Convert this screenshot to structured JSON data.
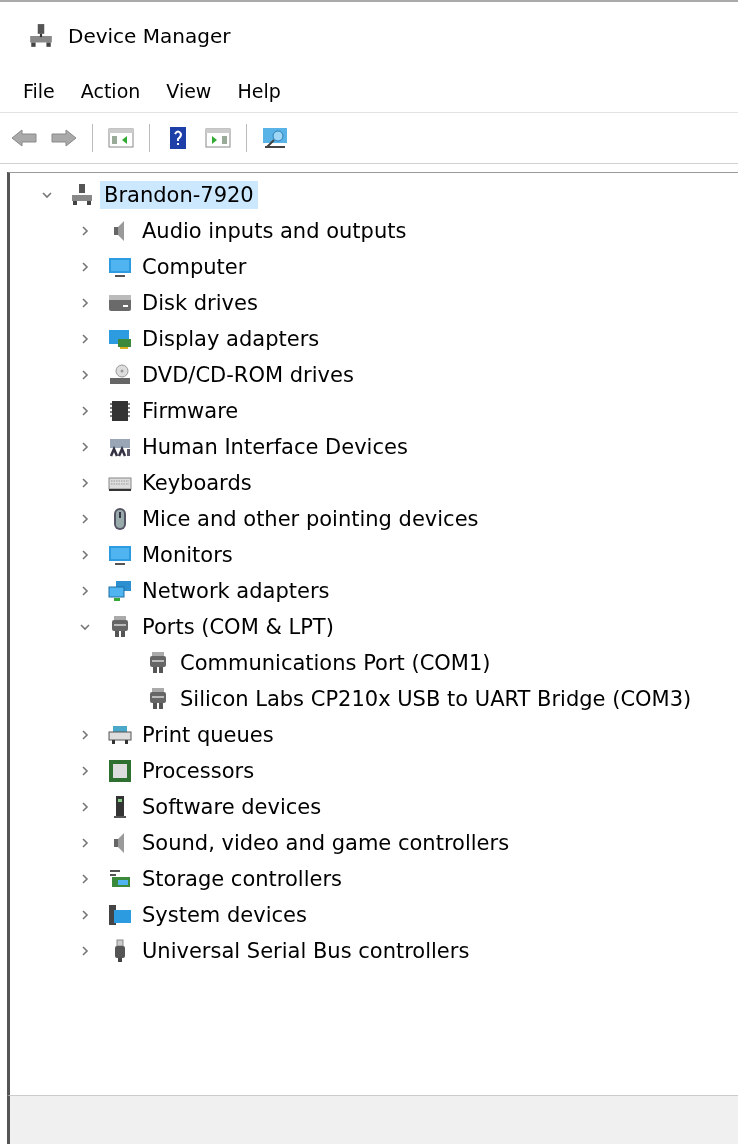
{
  "window": {
    "title": "Device Manager"
  },
  "menu": [
    "File",
    "Action",
    "View",
    "Help"
  ],
  "toolbar": [
    {
      "kind": "back"
    },
    {
      "kind": "forward"
    },
    {
      "kind": "sep"
    },
    {
      "kind": "tree"
    },
    {
      "kind": "sep"
    },
    {
      "kind": "help"
    },
    {
      "kind": "pane"
    },
    {
      "kind": "sep"
    },
    {
      "kind": "scan"
    }
  ],
  "tree": {
    "label": "Brandon-7920",
    "kind": "pc",
    "expanded": true,
    "selected": true,
    "children": [
      {
        "label": "Audio inputs and outputs",
        "kind": "speaker",
        "expanded": false,
        "selected": false
      },
      {
        "label": "Computer",
        "kind": "monitor",
        "expanded": false,
        "selected": false
      },
      {
        "label": "Disk drives",
        "kind": "disk",
        "expanded": false,
        "selected": false
      },
      {
        "label": "Display adapters",
        "kind": "display",
        "expanded": false,
        "selected": false
      },
      {
        "label": "DVD/CD-ROM drives",
        "kind": "dvd",
        "expanded": false,
        "selected": false
      },
      {
        "label": "Firmware",
        "kind": "chip",
        "expanded": false,
        "selected": false
      },
      {
        "label": "Human Interface Devices",
        "kind": "hid",
        "expanded": false,
        "selected": false
      },
      {
        "label": "Keyboards",
        "kind": "keyboard",
        "expanded": false,
        "selected": false
      },
      {
        "label": "Mice and other pointing devices",
        "kind": "mouse",
        "expanded": false,
        "selected": false
      },
      {
        "label": "Monitors",
        "kind": "monitor",
        "expanded": false,
        "selected": false
      },
      {
        "label": "Network adapters",
        "kind": "network",
        "expanded": false,
        "selected": false
      },
      {
        "label": "Ports (COM & LPT)",
        "kind": "port",
        "expanded": true,
        "selected": false,
        "children": [
          {
            "label": "Communications Port (COM1)",
            "kind": "port",
            "selected": false
          },
          {
            "label": "Silicon Labs CP210x USB to UART Bridge (COM3)",
            "kind": "port",
            "selected": false
          }
        ]
      },
      {
        "label": "Print queues",
        "kind": "printer",
        "expanded": false,
        "selected": false
      },
      {
        "label": "Processors",
        "kind": "cpu",
        "expanded": false,
        "selected": false
      },
      {
        "label": "Software devices",
        "kind": "tower",
        "expanded": false,
        "selected": false
      },
      {
        "label": "Sound, video and game controllers",
        "kind": "speaker",
        "expanded": false,
        "selected": false
      },
      {
        "label": "Storage controllers",
        "kind": "storage",
        "expanded": false,
        "selected": false
      },
      {
        "label": "System devices",
        "kind": "system",
        "expanded": false,
        "selected": false
      },
      {
        "label": "Universal Serial Bus controllers",
        "kind": "usb",
        "expanded": false,
        "selected": false
      }
    ]
  }
}
